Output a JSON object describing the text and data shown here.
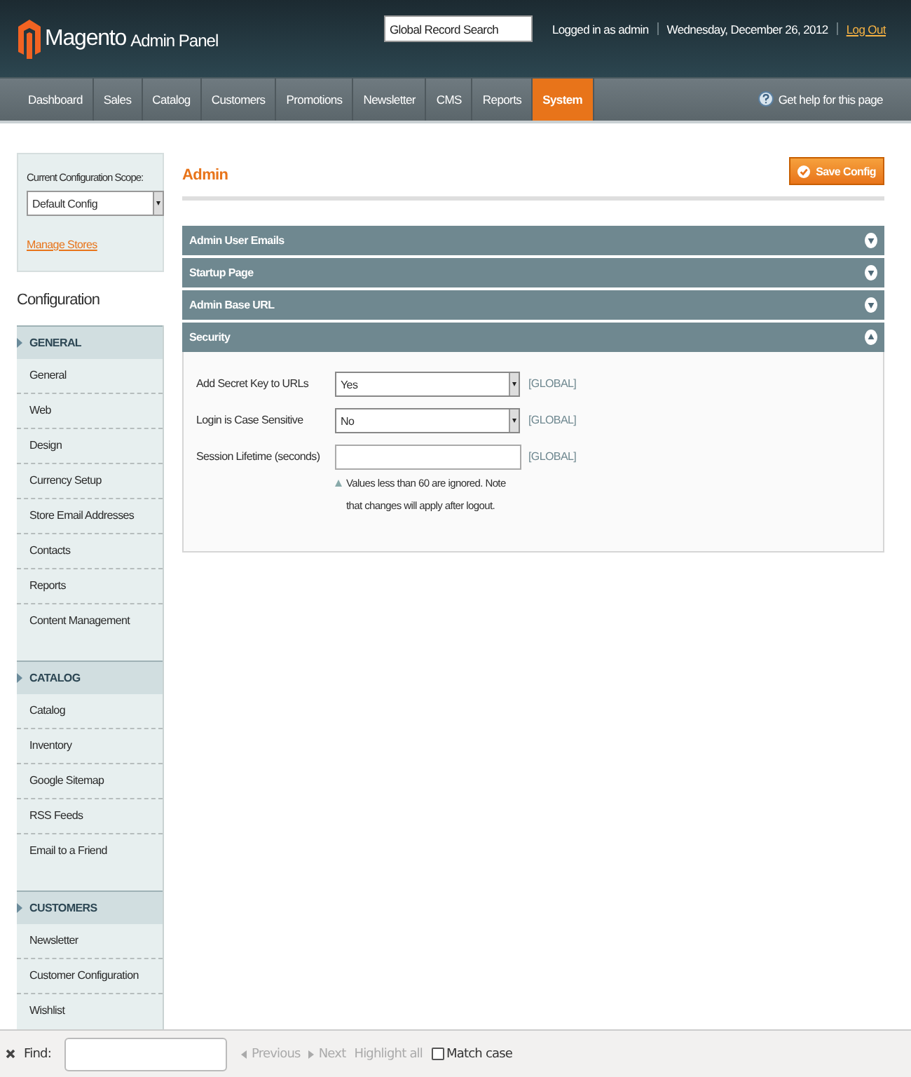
{
  "header": {
    "logo": "Magento",
    "logo_sub": "Admin Panel",
    "search": {
      "placeholder": "Global Record Search"
    },
    "user": "Logged in as admin",
    "date": "Wednesday, December 26, 2012",
    "logout": "Log Out"
  },
  "nav": {
    "items": [
      {
        "label": "Dashboard",
        "selected": false
      },
      {
        "label": "Sales",
        "selected": false
      },
      {
        "label": "Catalog",
        "selected": false
      },
      {
        "label": "Customers",
        "selected": false
      },
      {
        "label": "Promotions",
        "selected": false
      },
      {
        "label": "Newsletter",
        "selected": false
      },
      {
        "label": "CMS",
        "selected": false
      },
      {
        "label": "Reports",
        "selected": false
      },
      {
        "label": "System",
        "selected": true
      }
    ],
    "help": "Get help for this page"
  },
  "sidebar": {
    "scope_label": "Current Configuration Scope:",
    "scope_value": "Default Config",
    "manage_stores": "Manage Stores",
    "title": "Configuration",
    "groups": [
      {
        "label": "GENERAL",
        "items": [
          "General",
          "Web",
          "Design",
          "Currency Setup",
          "Store Email Addresses",
          "Contacts",
          "Reports",
          "Content Management"
        ]
      },
      {
        "label": "CATALOG",
        "items": [
          "Catalog",
          "Inventory",
          "Google Sitemap",
          "RSS Feeds",
          "Email to a Friend"
        ]
      },
      {
        "label": "CUSTOMERS",
        "items": [
          "Newsletter",
          "Customer Configuration",
          "Wishlist"
        ]
      }
    ]
  },
  "main": {
    "title": "Admin",
    "save_button": "Save Config",
    "sections": [
      {
        "title": "Admin User Emails",
        "expanded": false
      },
      {
        "title": "Startup Page",
        "expanded": false
      },
      {
        "title": "Admin Base URL",
        "expanded": false
      },
      {
        "title": "Security",
        "expanded": true,
        "fields": [
          {
            "kind": "select",
            "label": "Add Secret Key to URLs",
            "value": "Yes",
            "scope": "[GLOBAL]"
          },
          {
            "kind": "select",
            "label": "Login is Case Sensitive",
            "value": "No",
            "scope": "[GLOBAL]"
          },
          {
            "kind": "input",
            "label": "Session Lifetime (seconds)",
            "scope": "[GLOBAL]",
            "note": "Values less than 60 are ignored. Note that changes will apply after logout."
          }
        ]
      }
    ]
  },
  "find_bar": {
    "label": "Find:",
    "previous": "Previous",
    "next": "Next",
    "highlight": "Highlight all",
    "match_case": {
      "label": "Match case",
      "checked": false
    },
    "nav_disabled": true
  }
}
